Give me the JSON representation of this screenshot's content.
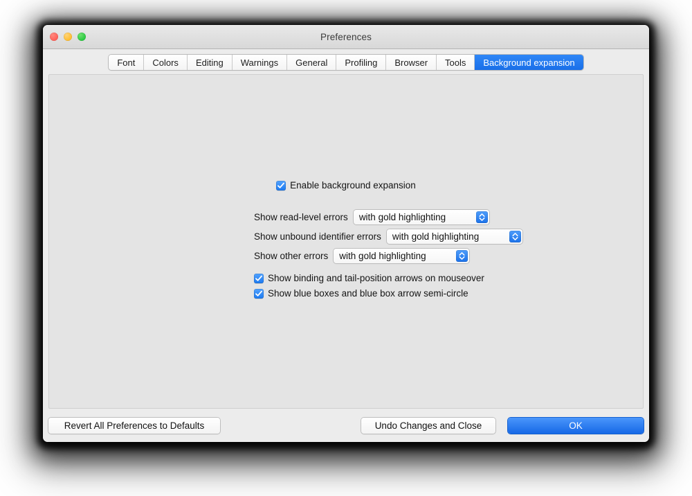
{
  "window": {
    "title": "Preferences",
    "traffic_lights": [
      {
        "name": "close",
        "color": "#ff5f57"
      },
      {
        "name": "minimize",
        "color": "#febc2e"
      },
      {
        "name": "maximize",
        "color": "#28c840"
      }
    ]
  },
  "tabs": [
    {
      "label": "Font",
      "selected": false
    },
    {
      "label": "Colors",
      "selected": false
    },
    {
      "label": "Editing",
      "selected": false
    },
    {
      "label": "Warnings",
      "selected": false
    },
    {
      "label": "General",
      "selected": false
    },
    {
      "label": "Profiling",
      "selected": false
    },
    {
      "label": "Browser",
      "selected": false
    },
    {
      "label": "Tools",
      "selected": false
    },
    {
      "label": "Background expansion",
      "selected": true
    }
  ],
  "content": {
    "enable_checkbox": {
      "label": "Enable background expansion",
      "checked": true
    },
    "dropdowns": [
      {
        "label": "Show read-level errors",
        "value": "with gold highlighting"
      },
      {
        "label": "Show unbound identifier errors",
        "value": "with gold highlighting"
      },
      {
        "label": "Show other errors",
        "value": "with gold highlighting"
      }
    ],
    "checkboxes": [
      {
        "label": "Show binding and tail-position arrows on mouseover",
        "checked": true
      },
      {
        "label": "Show blue boxes and blue box arrow semi-circle",
        "checked": true
      }
    ]
  },
  "footer": {
    "revert_label": "Revert All Preferences to Defaults",
    "undo_label": "Undo Changes and Close",
    "ok_label": "OK"
  },
  "colors": {
    "accent": "#1c7af0",
    "selected_tab": "#2f87f7",
    "panel_bg": "#e4e4e4",
    "chrome_bg": "#ececec"
  }
}
